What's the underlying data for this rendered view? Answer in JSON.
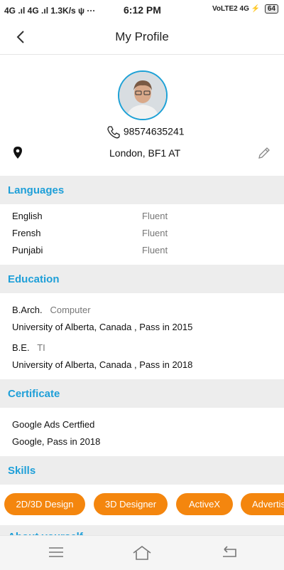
{
  "status_bar": {
    "left": "4G .ıl 4G .ıl 1.3K/s ψ ···",
    "time": "6:12 PM",
    "right": "VoLTE2 4G ⚡",
    "battery": "64"
  },
  "header": {
    "title": "My Profile",
    "back_icon": "chevron-left-icon"
  },
  "profile": {
    "phone": "98574635241",
    "location": "London, BF1 AT"
  },
  "languages": {
    "title": "Languages",
    "items": [
      {
        "name": "English",
        "level": "Fluent"
      },
      {
        "name": "Frensh",
        "level": "Fluent"
      },
      {
        "name": "Punjabi",
        "level": "Fluent"
      }
    ]
  },
  "education": {
    "title": "Education",
    "items": [
      {
        "degree": "B.Arch.",
        "field": "Computer",
        "detail": "University of Alberta, Canada , Pass in 2015"
      },
      {
        "degree": "B.E.",
        "field": "TI",
        "detail": "University of Alberta, Canada , Pass in 2018"
      }
    ]
  },
  "certificate": {
    "title": "Certificate",
    "name": "Google Ads Certfied",
    "detail": "Google, Pass in 2018"
  },
  "skills": {
    "title": "Skills",
    "items": [
      "2D/3D Design",
      "3D Designer",
      "ActiveX",
      "Advertis"
    ]
  },
  "next_section": {
    "title": "About yourself"
  },
  "colors": {
    "accent": "#1e9fd8",
    "chip": "#f4860e",
    "section_bg": "#ededed"
  }
}
